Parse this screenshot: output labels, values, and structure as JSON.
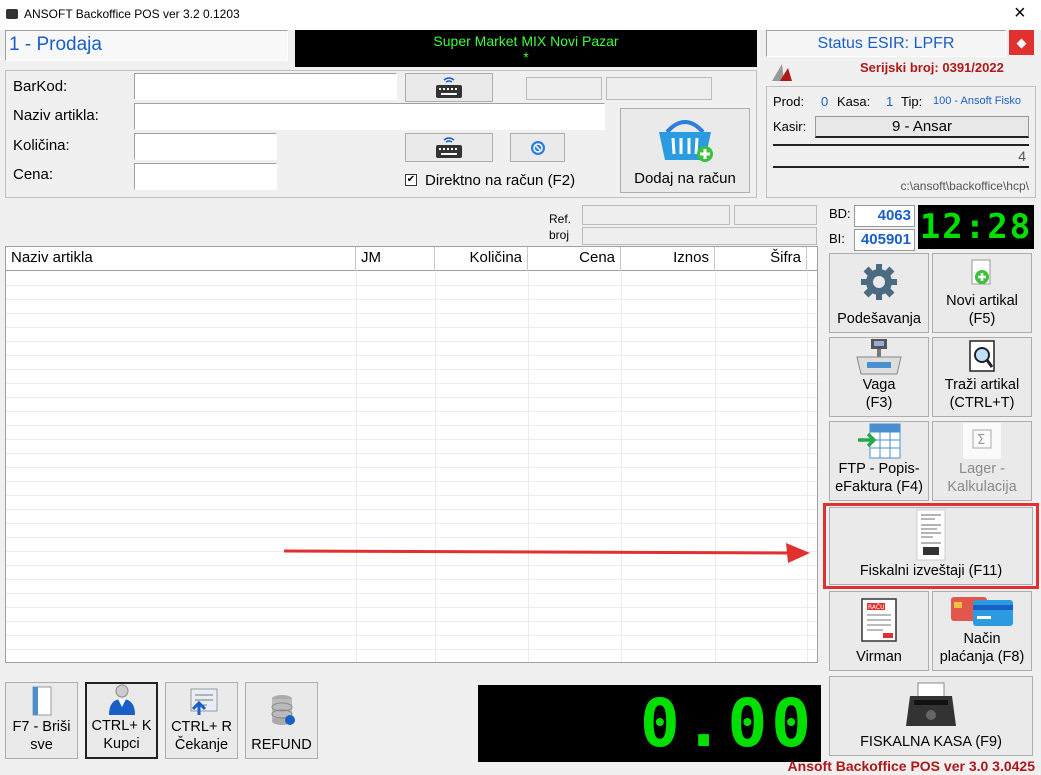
{
  "window": {
    "title": "ANSOFT Backoffice POS ver  3.2 0.1203",
    "close": "×"
  },
  "mode": {
    "label": "1 - Prodaja"
  },
  "store": {
    "name": "Super Market MIX Novi Pazar",
    "sub": "*"
  },
  "esir": {
    "status": "Status ESIR: LPFR",
    "serial": "Serijski broj: 0391/2022"
  },
  "form": {
    "barcode_label": "BarKod:",
    "name_label": "Naziv artikla:",
    "qty_label": "Količina:",
    "price_label": "Cena:",
    "barcode_value": "",
    "name_value": "",
    "qty_value": "",
    "price_value": "",
    "direct_label": "Direktno na račun (F2)",
    "direct_checked": "✔",
    "add_button": "Dodaj na račun"
  },
  "info": {
    "prod_label": "Prod:",
    "prod_value": "0",
    "kasa_label": "Kasa:",
    "kasa_value": "1",
    "tip_label": "Tip:",
    "tip_value": "100 - Ansoft Fisko",
    "kasir_label": "Kasir:",
    "kasir_value": "9 - Ansar",
    "count": "4",
    "path": "c:\\ansoft\\backoffice\\hcp\\"
  },
  "ref": {
    "label1": "Ref.",
    "label2": "broj"
  },
  "bd": {
    "bd_label": "BD:",
    "bd_value": "4063",
    "bi_label": "BI:",
    "bi_value": "405901",
    "clock": "12:28"
  },
  "table": {
    "columns": [
      "Naziv artikla",
      "JM",
      "Količina",
      "Cena",
      "Iznos",
      "Šifra"
    ],
    "rows": []
  },
  "side_buttons": {
    "settings": "Podešavanja",
    "new_item_1": "Novi artikal",
    "new_item_2": "(F5)",
    "scale_1": "Vaga",
    "scale_2": "(F3)",
    "search_1": "Traži artikal",
    "search_2": "(CTRL+T)",
    "ftp_1": "FTP - Popis-",
    "ftp_2": "eFaktura (F4)",
    "stock_1": "Lager -",
    "stock_2": "Kalkulacija",
    "fiscal_reports": "Fiskalni izveštaji (F11)",
    "virman": "Virman",
    "payment_1": "Način",
    "payment_2": "plaćanja (F8)",
    "fiscal_till": "FISKALNA KASA (F9)"
  },
  "bottom_buttons": {
    "delete_1": "F7 - Briši",
    "delete_2": "sve",
    "buyers_1": "CTRL+ K",
    "buyers_2": "Kupci",
    "waiting_1": "CTRL+ R",
    "waiting_2": "Čekanje",
    "refund": "REFUND"
  },
  "total": {
    "value": "0.00"
  },
  "footer": {
    "version": "Ansoft Backoffice POS ver 3.0 3.0425"
  },
  "colors": {
    "accent_blue": "#1a5ec8",
    "digital_green": "#00e000",
    "highlight_red": "#e03030",
    "serial_red": "#b01818"
  }
}
